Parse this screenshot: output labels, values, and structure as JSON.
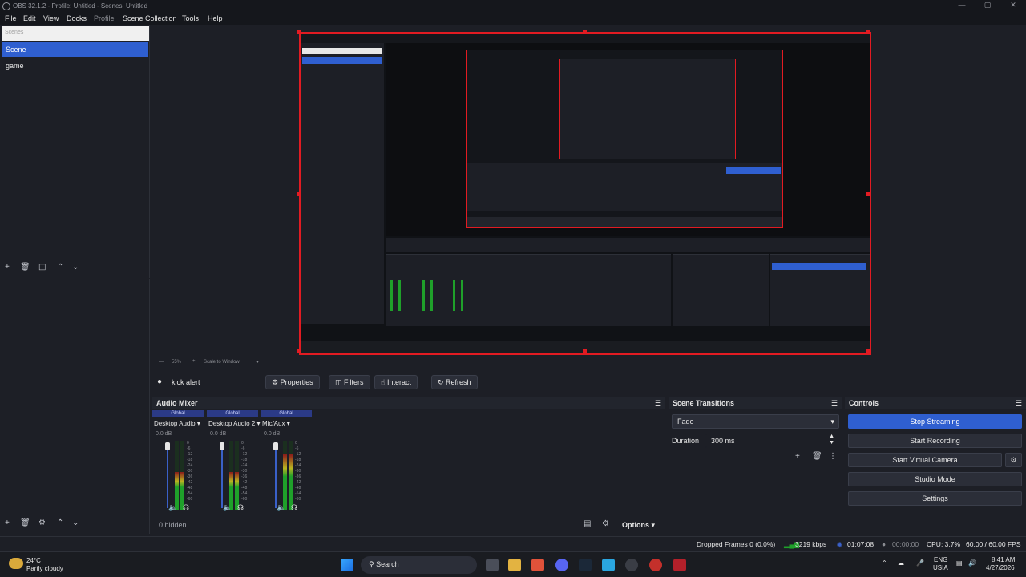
{
  "window": {
    "title": "OBS 32.1.2 - Profile: Untitled - Scenes: Untitled"
  },
  "menu": [
    "File",
    "Edit",
    "View",
    "Docks",
    "Profile",
    "Scene Collection",
    "Tools",
    "Help"
  ],
  "menu_disabled": [
    "Profile"
  ],
  "scenes": {
    "search_placeholder": "Scenes",
    "items": [
      {
        "label": "Scene",
        "selected": true
      },
      {
        "label": "game",
        "selected": false
      }
    ]
  },
  "zoom_bar": {
    "zoom": "55%",
    "mode": "Scale to Window"
  },
  "source_toolbar": {
    "source_name": "kick alert",
    "properties": "Properties",
    "filters": "Filters",
    "interact": "Interact",
    "refresh": "Refresh"
  },
  "audio_mixer": {
    "title": "Audio Mixer",
    "channels": [
      {
        "scope": "Global",
        "name": "Desktop Audio",
        "db": "0.0 dB",
        "level": 0.55
      },
      {
        "scope": "Global",
        "name": "Desktop Audio 2",
        "db": "0.0 dB",
        "level": 0.55
      },
      {
        "scope": "Global",
        "name": "Mic/Aux",
        "db": "0.0 dB",
        "level": 0.8
      }
    ],
    "scale": [
      "0",
      "-6",
      "-12",
      "-18",
      "-24",
      "-30",
      "-36",
      "-42",
      "-48",
      "-54",
      "-60"
    ],
    "hidden_label": "0 hidden",
    "options_label": "Options"
  },
  "scene_transitions": {
    "title": "Scene Transitions",
    "transition": "Fade",
    "duration_label": "Duration",
    "duration_value": "300 ms"
  },
  "controls": {
    "title": "Controls",
    "stop_streaming": "Stop Streaming",
    "start_recording": "Start Recording",
    "start_virtual_camera": "Start Virtual Camera",
    "studio_mode": "Studio Mode",
    "settings": "Settings"
  },
  "status_bar": {
    "dropped_frames": "Dropped Frames 0 (0.0%)",
    "bitrate": "3219 kbps",
    "stream_time": "01:07:08",
    "record_time": "00:00:00",
    "cpu": "CPU: 3.7%",
    "fps": "60.00 / 60.00 FPS"
  },
  "taskbar": {
    "weather_temp": "24°C",
    "weather_desc": "Partly cloudy",
    "search": "Search",
    "lang": "ENG",
    "region": "USIA",
    "time": "8:41 AM",
    "date": "4/27/2026"
  },
  "colors": {
    "accent": "#2f5fd0",
    "canvas_border": "#e21b22",
    "background": "#1d1f26"
  }
}
